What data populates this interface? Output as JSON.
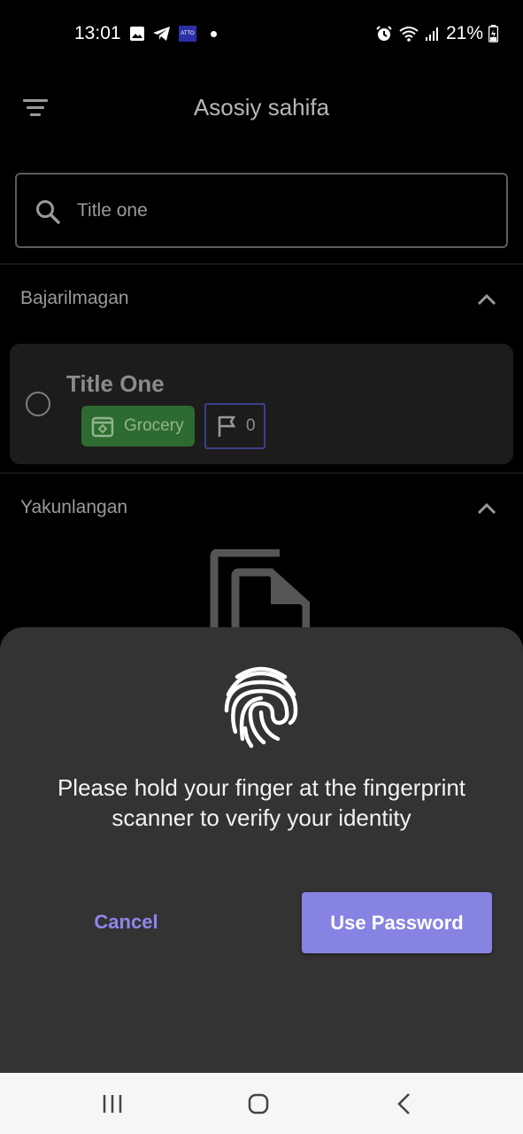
{
  "status_bar": {
    "time": "13:01",
    "battery": "21%",
    "icons": [
      "gallery-icon",
      "telegram-icon",
      "atto-icon",
      "dot-icon",
      "alarm-icon",
      "wifi-icon",
      "signal-icon",
      "battery-icon"
    ],
    "atto_label": "ATTO"
  },
  "appbar": {
    "title": "Asosiy sahifa",
    "menu_icon": "filter-menu-icon"
  },
  "search": {
    "value": "Title one",
    "placeholder": "Search",
    "icon": "search-icon"
  },
  "sections": {
    "pending": {
      "label": "Bajarilmagan"
    },
    "completed": {
      "label": "Yakunlangan"
    }
  },
  "task": {
    "title": "Title One",
    "category": "Grocery",
    "flag_count": "0",
    "colors": {
      "category_bg": "#2e6b31",
      "flag_border": "#3c3f8a"
    }
  },
  "dialog": {
    "message_line1": "Please hold your finger at the fingerprint",
    "message_line2": "scanner to verify your identity",
    "cancel_label": "Cancel",
    "use_password_label": "Use Password",
    "colors": {
      "accent": "#8683e3",
      "sheet_bg": "#333333"
    }
  },
  "navbar": {
    "buttons": [
      "recents-icon",
      "home-icon",
      "back-icon"
    ]
  }
}
